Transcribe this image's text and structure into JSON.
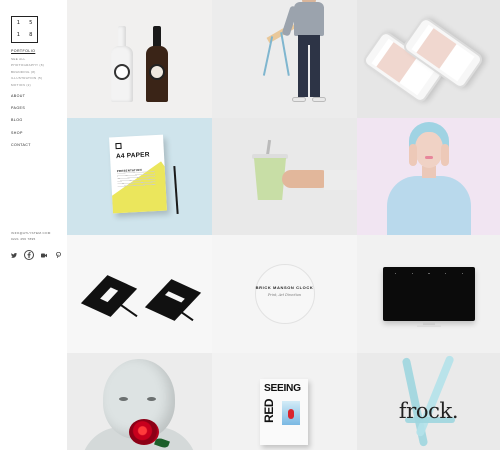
{
  "logo": {
    "chars": [
      "1",
      "5",
      "1",
      "8"
    ]
  },
  "nav": {
    "portfolio": "PORTFOLIO",
    "portfolio_sub": [
      "SEE ALL",
      "PHOTOGRAPHY (8)",
      "BRANDING (8)",
      "ILLUSTRATION (5)",
      "MOTION (2)"
    ],
    "about": "ABOUT",
    "pages": "PAGES",
    "blog": "BLOG",
    "shop": "SHOP",
    "contact": "CONTACT"
  },
  "contact_info": {
    "email": "INFO@ATLYSTEM.COM",
    "phone": "0221 456 7895"
  },
  "social": [
    {
      "icon": "twitter-icon",
      "glyph": "t"
    },
    {
      "icon": "facebook-icon",
      "glyph": "f"
    },
    {
      "icon": "vimeo-icon",
      "glyph": "v"
    },
    {
      "icon": "pinterest-icon",
      "glyph": "p"
    }
  ],
  "portfolio_tiles": [
    {
      "id": "bottles",
      "bg": "#f1f0ef"
    },
    {
      "id": "chair-man",
      "bg": "#ececec"
    },
    {
      "id": "phones",
      "bg": "#e6e6e6"
    },
    {
      "id": "a4-paper",
      "bg": "#cfe4ec",
      "title": "A4 PAPER",
      "subtitle": "PRESENTATION"
    },
    {
      "id": "cup",
      "bg": "#e9e9e9"
    },
    {
      "id": "portrait",
      "bg": "#f1e5f2"
    },
    {
      "id": "books",
      "bg": "#f7f7f7"
    },
    {
      "id": "clock",
      "bg": "#f5f5f5",
      "title": "BRICK MANSON CLOCK",
      "subtitle": "Print, Art Direction"
    },
    {
      "id": "monitor",
      "bg": "#f1f1f1"
    },
    {
      "id": "child-rose",
      "bg": "#ececec"
    },
    {
      "id": "seeing-red",
      "bg": "#f2f2f2",
      "line1": "SEEING",
      "line2": "RED"
    },
    {
      "id": "frock",
      "bg": "#eaeaea",
      "title": "frock."
    }
  ]
}
